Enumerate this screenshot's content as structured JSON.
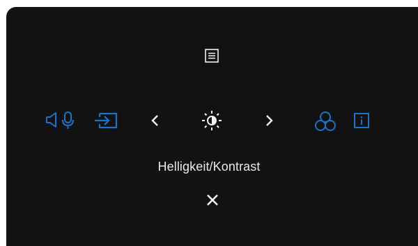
{
  "menu": {
    "current_item_label": "Helligkeit/Kontrast"
  },
  "icons": {
    "top": "menu-icon",
    "close": "close-icon",
    "audio": [
      "speaker-icon",
      "microphone-icon"
    ],
    "input": "input-source-icon",
    "prev": "chevron-left-icon",
    "current": "brightness-contrast-icon",
    "next": "chevron-right-icon",
    "color": "color-circles-icon",
    "info": "info-icon"
  },
  "colors": {
    "background": "#121212",
    "accent": "#1a73c9",
    "foreground": "#f2f2f2"
  }
}
